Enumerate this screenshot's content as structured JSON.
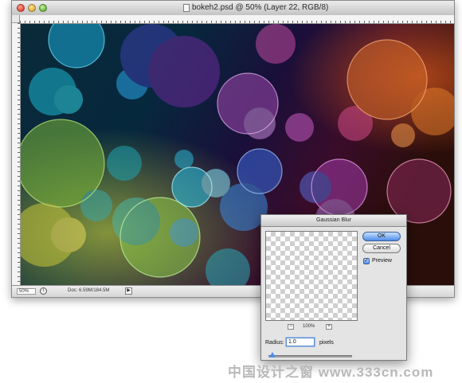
{
  "window": {
    "title": "bokeh2.psd @ 50% (Layer 22, RGB/8)"
  },
  "status_bar": {
    "zoom": "50%",
    "doc_info": "Doc: 6.59M/184.5M",
    "menu_arrow": "▶"
  },
  "dialog": {
    "title": "Gaussian Blur",
    "ok_label": "OK",
    "cancel_label": "Cancel",
    "preview_label": "Preview",
    "preview_checked": "✓",
    "zoom_minus": "−",
    "zoom_plus": "+",
    "zoom_percent": "100%",
    "radius_label": "Radius:",
    "radius_value": "1.0",
    "radius_unit": "pixels"
  },
  "watermark": "中国设计之窗 www.333cn.com",
  "colors": {
    "accent_blue": "#4f8ee8",
    "canvas_dark": "#05101a"
  }
}
